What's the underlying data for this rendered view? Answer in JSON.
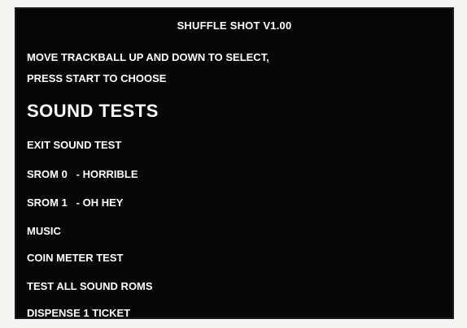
{
  "screen": {
    "title": "SHUFFLE SHOT V1.00",
    "instructions": [
      "MOVE TRACKBALL UP AND DOWN TO SELECT,",
      "PRESS START TO CHOOSE"
    ],
    "heading": "SOUND TESTS",
    "menu": [
      "EXIT SOUND TEST",
      "SROM 0   - HORRIBLE",
      "SROM 1   - OH HEY",
      "MUSIC",
      "COIN METER TEST",
      "TEST ALL SOUND ROMS",
      "DISPENSE 1 TICKET"
    ]
  }
}
